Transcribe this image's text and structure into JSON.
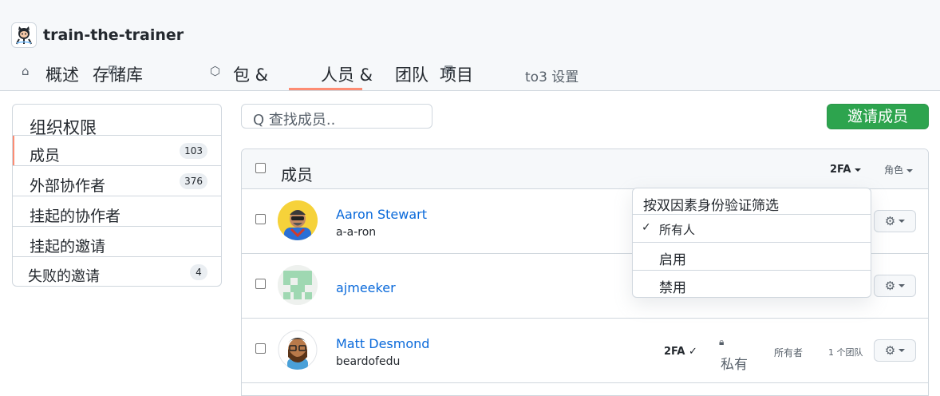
{
  "org": {
    "name": "train-the-trainer"
  },
  "tabs": [
    {
      "label": "概述",
      "icon": "home-icon"
    },
    {
      "label": "存储库",
      "icon": "repo-icon"
    },
    {
      "label": "包 &",
      "icon": "package-icon"
    },
    {
      "label": "人员 &",
      "icon": "people-icon",
      "active": true
    },
    {
      "label": "团队",
      "icon": "team-icon"
    },
    {
      "label": "项目",
      "icon": "project-icon"
    },
    {
      "label": "to3 设置",
      "icon": "gear-icon"
    }
  ],
  "sidebar": {
    "title": "组织权限",
    "items": [
      {
        "label": "成员",
        "count": "103",
        "active": true
      },
      {
        "label": "外部协作者",
        "count": "376"
      },
      {
        "label": "挂起的协作者",
        "count": ""
      },
      {
        "label": "挂起的邀请",
        "count": ""
      },
      {
        "label": "失败的邀请",
        "count": "4"
      }
    ]
  },
  "search": {
    "placeholder": "Q 查找成员.."
  },
  "invite_button": "邀请成员",
  "table": {
    "header_title": "成员",
    "filter_2fa": "2FA",
    "filter_role": "角色"
  },
  "members": [
    {
      "name": "Aaron Stewart",
      "login": "a-a-ron"
    },
    {
      "name": "ajmeeker",
      "login": ""
    },
    {
      "name": "Matt Desmond",
      "login": "beardofedu",
      "twofa": "2FA ✓",
      "visibility": "私有",
      "role": "所有者",
      "teams": "1 个团队"
    }
  ],
  "dropdown_2fa": {
    "title": "按双因素身份验证筛选",
    "options": [
      {
        "label": "所有人",
        "selected": true
      },
      {
        "label": "启用"
      },
      {
        "label": "禁用"
      }
    ]
  },
  "colors": {
    "accent": "#fd8c73",
    "link": "#0969da",
    "primary_button": "#2da44e"
  }
}
